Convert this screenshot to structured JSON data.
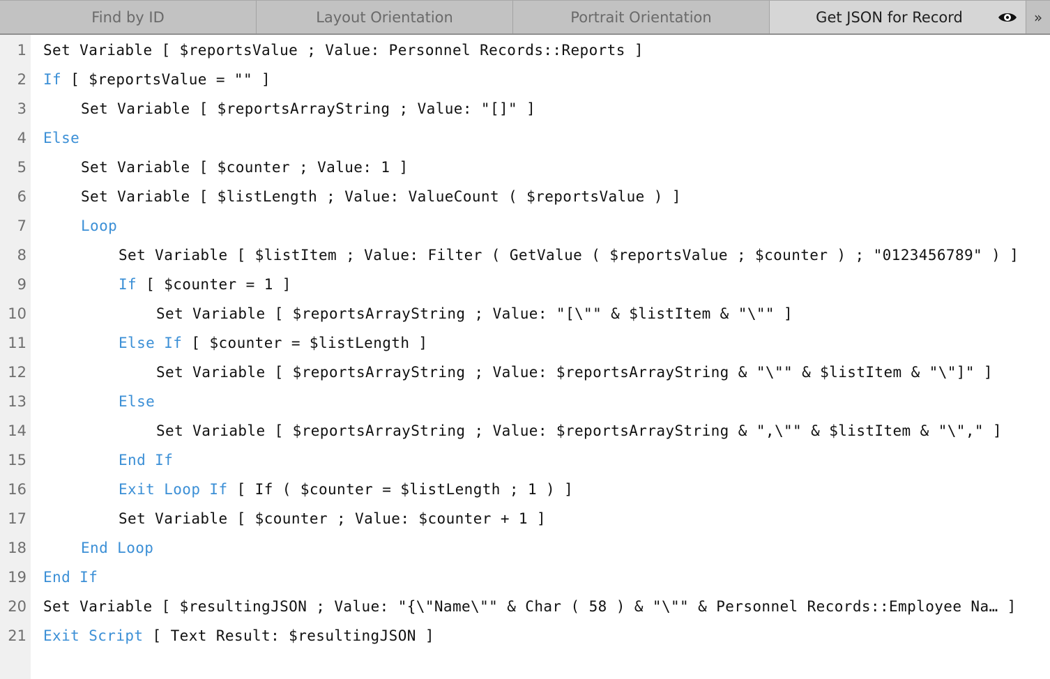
{
  "tabs": [
    {
      "label": "Find by ID",
      "active": false
    },
    {
      "label": "Layout Orientation",
      "active": false
    },
    {
      "label": "Portrait Orientation",
      "active": false
    },
    {
      "label": "Get JSON for Record",
      "active": true
    }
  ],
  "overflow_label": "»",
  "icons": {
    "eye": "eye-icon",
    "overflow": "chevron-double-right-icon"
  },
  "colors": {
    "keyword": "#3b8fd6",
    "text": "#111111",
    "gutter": "#f0f0f0",
    "tabbar": "#c2c2c2",
    "active_tab": "#d6d6d6"
  },
  "script_lines": [
    {
      "num": "1",
      "indent": 0,
      "kw": "Set Variable",
      "rest": " [ $reportsValue ; Value: Personnel Records::Reports ]",
      "is_control": false
    },
    {
      "num": "2",
      "indent": 0,
      "kw": "If",
      "rest": " [ $reportsValue = \"\" ]",
      "is_control": true
    },
    {
      "num": "3",
      "indent": 1,
      "kw": "Set Variable",
      "rest": " [ $reportsArrayString ; Value: \"[]\" ]",
      "is_control": false
    },
    {
      "num": "4",
      "indent": 0,
      "kw": "Else",
      "rest": "",
      "is_control": true
    },
    {
      "num": "5",
      "indent": 1,
      "kw": "Set Variable",
      "rest": " [ $counter ; Value: 1 ]",
      "is_control": false
    },
    {
      "num": "6",
      "indent": 1,
      "kw": "Set Variable",
      "rest": " [ $listLength ; Value: ValueCount ( $reportsValue ) ]",
      "is_control": false
    },
    {
      "num": "7",
      "indent": 1,
      "kw": "Loop",
      "rest": "",
      "is_control": true
    },
    {
      "num": "8",
      "indent": 2,
      "kw": "Set Variable",
      "rest": " [ $listItem ; Value: Filter ( GetValue ( $reportsValue ; $counter ) ; \"0123456789\" ) ]",
      "is_control": false
    },
    {
      "num": "9",
      "indent": 2,
      "kw": "If",
      "rest": " [ $counter = 1 ]",
      "is_control": true
    },
    {
      "num": "10",
      "indent": 3,
      "kw": "Set Variable",
      "rest": " [ $reportsArrayString ; Value: \"[\\\"\" & $listItem & \"\\\"\" ]",
      "is_control": false
    },
    {
      "num": "11",
      "indent": 2,
      "kw": "Else If",
      "rest": " [ $counter = $listLength ]",
      "is_control": true
    },
    {
      "num": "12",
      "indent": 3,
      "kw": "Set Variable",
      "rest": " [ $reportsArrayString ; Value: $reportsArrayString & \"\\\"\" & $listItem & \"\\\"]\" ]",
      "is_control": false
    },
    {
      "num": "13",
      "indent": 2,
      "kw": "Else",
      "rest": "",
      "is_control": true
    },
    {
      "num": "14",
      "indent": 3,
      "kw": "Set Variable",
      "rest": " [ $reportsArrayString ; Value: $reportsArrayString & \",\\\"\" & $listItem & \"\\\",\" ]",
      "is_control": false
    },
    {
      "num": "15",
      "indent": 2,
      "kw": "End If",
      "rest": "",
      "is_control": true
    },
    {
      "num": "16",
      "indent": 2,
      "kw": "Exit Loop If",
      "rest": " [ If ( $counter = $listLength ; 1 ) ]",
      "is_control": true
    },
    {
      "num": "17",
      "indent": 2,
      "kw": "Set Variable",
      "rest": " [ $counter ; Value: $counter + 1 ]",
      "is_control": false
    },
    {
      "num": "18",
      "indent": 1,
      "kw": "End Loop",
      "rest": "",
      "is_control": true
    },
    {
      "num": "19",
      "indent": 0,
      "kw": "End If",
      "rest": "",
      "is_control": true
    },
    {
      "num": "20",
      "indent": 0,
      "kw": "Set Variable",
      "rest": " [ $resultingJSON ; Value: \"{\\\"Name\\\"\" & Char ( 58 ) & \"\\\"\" & Personnel Records::Employee Na… ]",
      "is_control": false
    },
    {
      "num": "21",
      "indent": 0,
      "kw": "Exit Script",
      "rest": " [ Text Result: $resultingJSON ]",
      "is_control": true
    }
  ]
}
